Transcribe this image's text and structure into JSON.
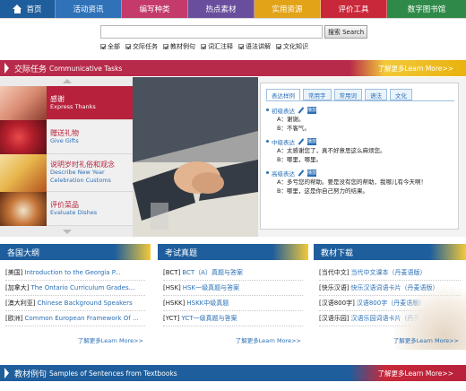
{
  "nav": {
    "items": [
      {
        "label": "首页",
        "color": "#1f5e9c"
      },
      {
        "label": "活动资讯",
        "color": "#2f72b8"
      },
      {
        "label": "编写种类",
        "color": "#c43a6a"
      },
      {
        "label": "热点素材",
        "color": "#6a4e9e"
      },
      {
        "label": "实用资源",
        "color": "#e2a318"
      },
      {
        "label": "评价工具",
        "color": "#c8283a"
      },
      {
        "label": "数字图书馆",
        "color": "#2f8a4a"
      }
    ],
    "active_index": 4
  },
  "search": {
    "value": "",
    "button_label": "搜索 Search",
    "filters": [
      "全部",
      "交际任务",
      "教材例句",
      "词汇注释",
      "语法讲解",
      "文化知识"
    ]
  },
  "tasks_section": {
    "title_cn": "交际任务",
    "title_en": "Communicative Tasks",
    "more_label": "了解更多Learn More>>",
    "items": [
      {
        "cn": "感谢",
        "en": "Express Thanks"
      },
      {
        "cn": "赠送礼物",
        "en": "Give Gifts"
      },
      {
        "cn": "说明岁时礼俗和观念",
        "en": "Describe New Year Celebration Customs"
      },
      {
        "cn": "评价菜品",
        "en": "Evaluate Dishes"
      }
    ],
    "active_index": 0,
    "tabs": [
      "表达样例",
      "常用字",
      "常用词",
      "语法",
      "文化"
    ],
    "active_tab": 0,
    "play_label": "播放",
    "levels": [
      {
        "title": "初级表达",
        "lines": [
          "A：谢谢。",
          "B：不客气。"
        ]
      },
      {
        "title": "中级表达",
        "lines": [
          "A：太感谢您了，真不好意思这么麻烦您。",
          "B：哪里，哪里。"
        ]
      },
      {
        "title": "高级表达",
        "lines": [
          "A：多亏您的帮助。要是没有您的帮助，我哪儿有今天啊！",
          "B：哪里，这是你自己努力的结果。"
        ]
      }
    ]
  },
  "columns": [
    {
      "title": "各国大纲",
      "items": [
        {
          "tag": "[美国]",
          "link": "Introduction to the Georgia P..."
        },
        {
          "tag": "[加拿大]",
          "link": "The Ontario Curriculum Grades..."
        },
        {
          "tag": "[澳大利亚]",
          "link": "Chinese Background Speakers"
        },
        {
          "tag": "[欧洲]",
          "link": "Common European Framework Of ..."
        }
      ],
      "more": "了解更多Learn More>>"
    },
    {
      "title": "考试真题",
      "items": [
        {
          "tag": "[BCT]",
          "link": "BCT（A）真题与答案"
        },
        {
          "tag": "[HSK]",
          "link": "HSK一级真题与答案"
        },
        {
          "tag": "[HSKK]",
          "link": "HSKK中级真题"
        },
        {
          "tag": "[YCT]",
          "link": "YCT一级真题与答案"
        }
      ],
      "more": "了解更多Learn More>>"
    },
    {
      "title": "教材下载",
      "items": [
        {
          "tag": "[当代中文]",
          "link": "当代中文课本（丹麦语版）"
        },
        {
          "tag": "[快乐汉语]",
          "link": "快乐汉语词语卡片（丹麦语版）"
        },
        {
          "tag": "[汉语800字]",
          "link": "汉语800字（丹麦语版）"
        },
        {
          "tag": "[汉语乐园]",
          "link": "汉语乐园词语卡片（丹麦语版）"
        }
      ],
      "more": "了解更多Learn More>>"
    }
  ],
  "samples_section": {
    "title_cn": "教材例句",
    "title_en": "Samples of Sentences from Textbooks",
    "more_label": "了解更多Learn More>>"
  }
}
